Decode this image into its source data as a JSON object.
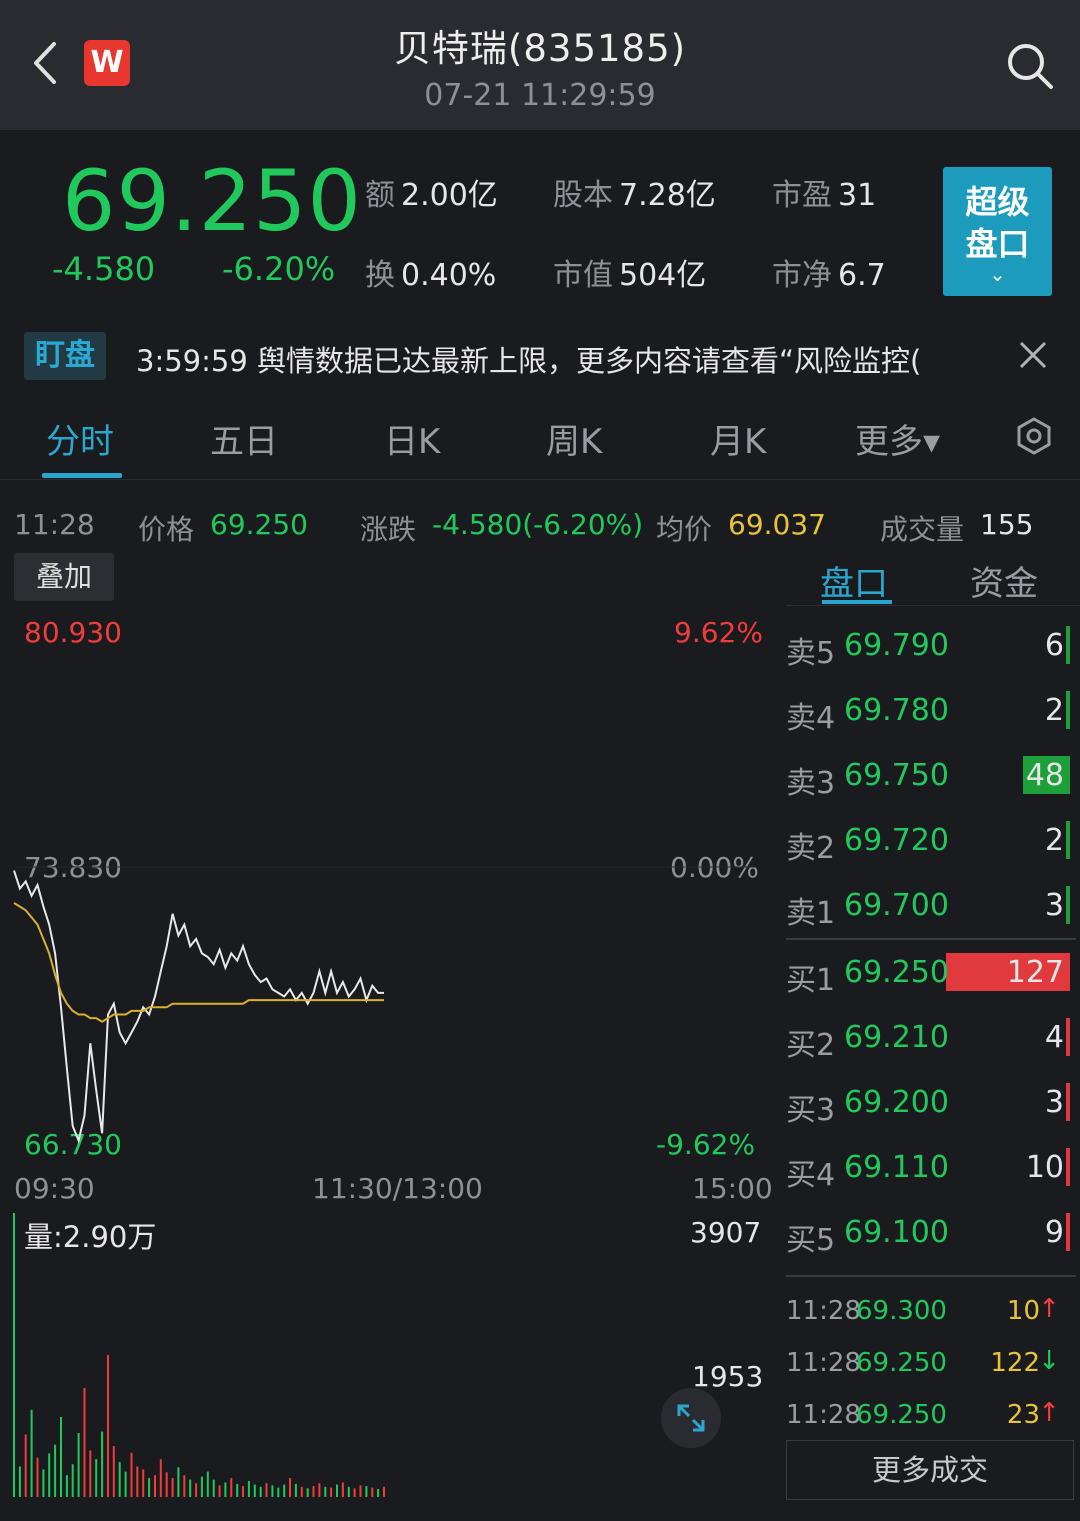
{
  "header": {
    "title": "贝特瑞(835185)",
    "subtitle": "07-21 11:29:59",
    "logo_text": "W"
  },
  "quote": {
    "price": "69.250",
    "change": "-4.580",
    "change_pct": "-6.20%",
    "stats": [
      {
        "label": "额",
        "value": "2.00亿"
      },
      {
        "label": "股本",
        "value": "7.28亿"
      },
      {
        "label": "市盈",
        "value": "31"
      },
      {
        "label": "换",
        "value": "0.40%"
      },
      {
        "label": "市值",
        "value": "504亿"
      },
      {
        "label": "市净",
        "value": "6.7"
      }
    ],
    "super_button": {
      "line1": "超级",
      "line2": "盘口"
    }
  },
  "alert": {
    "tag": "盯盘",
    "text": "3:59:59 舆情数据已达最新上限，更多内容请查看“风险监控(",
    "tag_color": "#29a9d4"
  },
  "tabs": [
    {
      "label": "分时",
      "active": true
    },
    {
      "label": "五日"
    },
    {
      "label": "日K"
    },
    {
      "label": "周K"
    },
    {
      "label": "月K"
    },
    {
      "label": "更多▾"
    }
  ],
  "info_row": {
    "time": "11:28",
    "price_label": "价格",
    "price_value": "69.250",
    "chg_label": "涨跌",
    "chg_value": "-4.580(-6.20%)",
    "avg_label": "均价",
    "avg_value": "69.037",
    "vol_label": "成交量",
    "vol_value": "155"
  },
  "overlay_button": "叠加",
  "chart_axes": {
    "price_top": "80.930",
    "pct_top": "9.62%",
    "price_mid": "73.830",
    "pct_mid": "0.00%",
    "price_bottom": "66.730",
    "pct_bottom": "-9.62%",
    "time_start": "09:30",
    "time_mid": "11:30/13:00",
    "time_end": "15:00",
    "volume_label": "量:2.90万",
    "volume_top": "3907",
    "volume_mid": "1953"
  },
  "chart_data": {
    "type": "line",
    "ylim": [
      66.73,
      80.93
    ],
    "series": [
      {
        "values": [
          74.3,
          73.8,
          74.0,
          73.6,
          73.9,
          73.3,
          72.8,
          72.0,
          70.5,
          68.8,
          67.2,
          66.8,
          67.5,
          69.5,
          68.2,
          67.0,
          70.3,
          70.6,
          69.8,
          69.5,
          69.8,
          70.1,
          70.5,
          70.3,
          70.8,
          71.5,
          72.2,
          73.1,
          72.5,
          72.8,
          72.2,
          72.4,
          72.0,
          71.9,
          71.7,
          72.1,
          71.6,
          72.0,
          71.8,
          72.2,
          71.7,
          71.4,
          71.2,
          71.3,
          71.0,
          70.9,
          70.8,
          71.0,
          70.7,
          70.9,
          70.6,
          70.9,
          71.5,
          70.9,
          71.5,
          70.9,
          71.2,
          70.8,
          71.0,
          71.3,
          70.7,
          71.1,
          70.9,
          70.9
        ]
      },
      {
        "values": [
          73.4,
          73.3,
          73.2,
          73.0,
          72.8,
          72.4,
          72.0,
          71.4,
          70.9,
          70.6,
          70.4,
          70.3,
          70.3,
          70.2,
          70.2,
          70.1,
          70.2,
          70.3,
          70.3,
          70.3,
          70.4,
          70.4,
          70.4,
          70.5,
          70.5,
          70.5,
          70.5,
          70.6,
          70.6,
          70.6,
          70.6,
          70.6,
          70.6,
          70.6,
          70.6,
          70.6,
          70.6,
          70.6,
          70.6,
          70.6,
          70.7,
          70.7,
          70.7,
          70.7,
          70.7,
          70.7,
          70.7,
          70.7,
          70.7,
          70.7,
          70.7,
          70.7,
          70.7,
          70.7,
          70.7,
          70.7,
          70.7,
          70.7,
          70.7,
          70.7,
          70.7,
          70.7,
          70.7,
          70.7
        ]
      }
    ],
    "volume_ylim": [
      0,
      3907
    ],
    "volumes": [
      3907,
      420,
      860,
      1200,
      540,
      380,
      600,
      720,
      1100,
      300,
      450,
      880,
      1500,
      640,
      520,
      900,
      1953,
      700,
      480,
      350,
      610,
      420,
      380,
      260,
      300,
      520,
      340,
      260,
      410,
      300,
      240,
      190,
      280,
      350,
      240,
      160,
      200,
      260,
      180,
      150,
      220,
      170,
      140,
      190,
      160,
      130,
      170,
      260,
      180,
      140,
      120,
      150,
      190,
      140,
      130,
      170,
      200,
      140,
      120,
      160,
      150,
      130,
      110,
      140
    ]
  },
  "right_panel": {
    "tabs": [
      {
        "label": "盘口",
        "active": true
      },
      {
        "label": "资金"
      }
    ],
    "asks": [
      {
        "side": "卖5",
        "price": "69.790",
        "vol": "6",
        "bar": 0.03
      },
      {
        "side": "卖4",
        "price": "69.780",
        "vol": "2",
        "bar": 0.01
      },
      {
        "side": "卖3",
        "price": "69.750",
        "vol": "48",
        "bar": 0.38
      },
      {
        "side": "卖2",
        "price": "69.720",
        "vol": "2",
        "bar": 0.01
      },
      {
        "side": "卖1",
        "price": "69.700",
        "vol": "3",
        "bar": 0.02
      }
    ],
    "bids": [
      {
        "side": "买1",
        "price": "69.250",
        "vol": "127",
        "bar": 1.0
      },
      {
        "side": "买2",
        "price": "69.210",
        "vol": "4",
        "bar": 0.02
      },
      {
        "side": "买3",
        "price": "69.200",
        "vol": "3",
        "bar": 0.02
      },
      {
        "side": "买4",
        "price": "69.110",
        "vol": "10",
        "bar": 0.03
      },
      {
        "side": "买5",
        "price": "69.100",
        "vol": "9",
        "bar": 0.03
      }
    ],
    "ticks": [
      {
        "time": "11:28",
        "price": "69.300",
        "vol": "10",
        "arrow": "↑",
        "dir": "up"
      },
      {
        "time": "11:28",
        "price": "69.250",
        "vol": "122",
        "arrow": "↓",
        "dir": "down"
      },
      {
        "time": "11:28",
        "price": "69.250",
        "vol": "23",
        "arrow": "↑",
        "dir": "up"
      }
    ],
    "more_button": "更多成交"
  },
  "colors": {
    "up": "#f23b3b",
    "down": "#21c95c",
    "accent": "#2aa7cf",
    "avg_line": "#d9b12c"
  }
}
